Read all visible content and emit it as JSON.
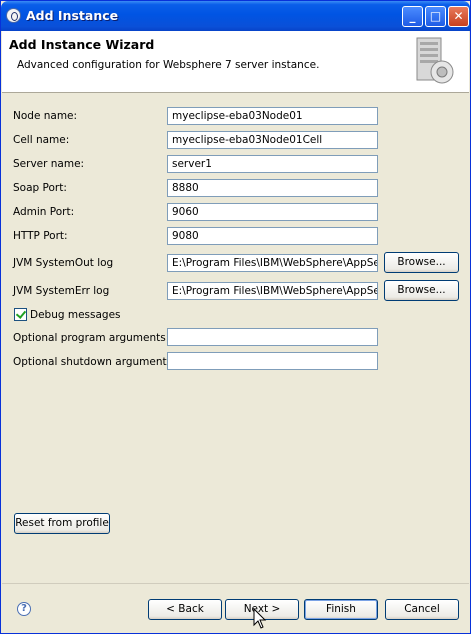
{
  "window": {
    "title": "Add Instance"
  },
  "titlebar_buttons": {
    "minimize": "_",
    "maximize": "□",
    "close": "✕"
  },
  "header": {
    "title": "Add Instance Wizard",
    "description": "Advanced configuration for Websphere 7 server instance.",
    "image_icon": "server-icon"
  },
  "form": {
    "node_name": {
      "label": "Node name:",
      "value": "myeclipse-eba03Node01"
    },
    "cell_name": {
      "label": "Cell name:",
      "value": "myeclipse-eba03Node01Cell"
    },
    "server_name": {
      "label": "Server name:",
      "value": "server1"
    },
    "soap_port": {
      "label": "Soap Port:",
      "value": "8880"
    },
    "admin_port": {
      "label": "Admin Port:",
      "value": "9060"
    },
    "http_port": {
      "label": "HTTP Port:",
      "value": "9080"
    },
    "jvm_out": {
      "label": "JVM SystemOut log",
      "value": "E:\\Program Files\\IBM\\WebSphere\\AppServ",
      "browse": "Browse..."
    },
    "jvm_err": {
      "label": "JVM SystemErr log",
      "value": "E:\\Program Files\\IBM\\WebSphere\\AppServ",
      "browse": "Browse..."
    },
    "debug": {
      "label": "Debug messages",
      "checked": true
    },
    "program_args": {
      "label": "Optional program arguments:",
      "value": ""
    },
    "shutdown_args": {
      "label": "Optional shutdown arguments:",
      "value": ""
    },
    "reset_button": "Reset from profile"
  },
  "footer": {
    "help_icon": "help-icon",
    "help_glyph": "?",
    "back": "< Back",
    "next": "Next >",
    "finish": "Finish",
    "cancel": "Cancel"
  }
}
